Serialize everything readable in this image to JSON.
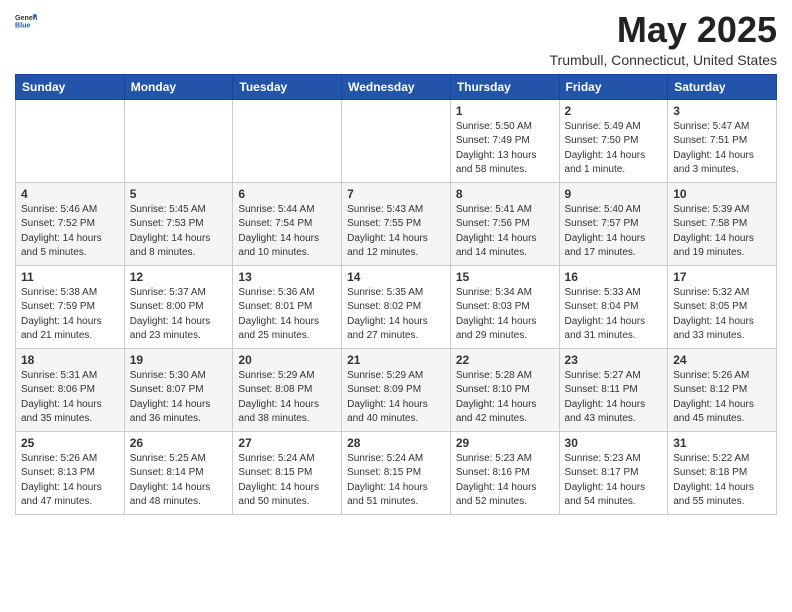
{
  "header": {
    "logo_general": "General",
    "logo_blue": "Blue",
    "month_title": "May 2025",
    "location": "Trumbull, Connecticut, United States"
  },
  "weekdays": [
    "Sunday",
    "Monday",
    "Tuesday",
    "Wednesday",
    "Thursday",
    "Friday",
    "Saturday"
  ],
  "weeks": [
    [
      {
        "day": "",
        "info": ""
      },
      {
        "day": "",
        "info": ""
      },
      {
        "day": "",
        "info": ""
      },
      {
        "day": "",
        "info": ""
      },
      {
        "day": "1",
        "info": "Sunrise: 5:50 AM\nSunset: 7:49 PM\nDaylight: 13 hours\nand 58 minutes."
      },
      {
        "day": "2",
        "info": "Sunrise: 5:49 AM\nSunset: 7:50 PM\nDaylight: 14 hours\nand 1 minute."
      },
      {
        "day": "3",
        "info": "Sunrise: 5:47 AM\nSunset: 7:51 PM\nDaylight: 14 hours\nand 3 minutes."
      }
    ],
    [
      {
        "day": "4",
        "info": "Sunrise: 5:46 AM\nSunset: 7:52 PM\nDaylight: 14 hours\nand 5 minutes."
      },
      {
        "day": "5",
        "info": "Sunrise: 5:45 AM\nSunset: 7:53 PM\nDaylight: 14 hours\nand 8 minutes."
      },
      {
        "day": "6",
        "info": "Sunrise: 5:44 AM\nSunset: 7:54 PM\nDaylight: 14 hours\nand 10 minutes."
      },
      {
        "day": "7",
        "info": "Sunrise: 5:43 AM\nSunset: 7:55 PM\nDaylight: 14 hours\nand 12 minutes."
      },
      {
        "day": "8",
        "info": "Sunrise: 5:41 AM\nSunset: 7:56 PM\nDaylight: 14 hours\nand 14 minutes."
      },
      {
        "day": "9",
        "info": "Sunrise: 5:40 AM\nSunset: 7:57 PM\nDaylight: 14 hours\nand 17 minutes."
      },
      {
        "day": "10",
        "info": "Sunrise: 5:39 AM\nSunset: 7:58 PM\nDaylight: 14 hours\nand 19 minutes."
      }
    ],
    [
      {
        "day": "11",
        "info": "Sunrise: 5:38 AM\nSunset: 7:59 PM\nDaylight: 14 hours\nand 21 minutes."
      },
      {
        "day": "12",
        "info": "Sunrise: 5:37 AM\nSunset: 8:00 PM\nDaylight: 14 hours\nand 23 minutes."
      },
      {
        "day": "13",
        "info": "Sunrise: 5:36 AM\nSunset: 8:01 PM\nDaylight: 14 hours\nand 25 minutes."
      },
      {
        "day": "14",
        "info": "Sunrise: 5:35 AM\nSunset: 8:02 PM\nDaylight: 14 hours\nand 27 minutes."
      },
      {
        "day": "15",
        "info": "Sunrise: 5:34 AM\nSunset: 8:03 PM\nDaylight: 14 hours\nand 29 minutes."
      },
      {
        "day": "16",
        "info": "Sunrise: 5:33 AM\nSunset: 8:04 PM\nDaylight: 14 hours\nand 31 minutes."
      },
      {
        "day": "17",
        "info": "Sunrise: 5:32 AM\nSunset: 8:05 PM\nDaylight: 14 hours\nand 33 minutes."
      }
    ],
    [
      {
        "day": "18",
        "info": "Sunrise: 5:31 AM\nSunset: 8:06 PM\nDaylight: 14 hours\nand 35 minutes."
      },
      {
        "day": "19",
        "info": "Sunrise: 5:30 AM\nSunset: 8:07 PM\nDaylight: 14 hours\nand 36 minutes."
      },
      {
        "day": "20",
        "info": "Sunrise: 5:29 AM\nSunset: 8:08 PM\nDaylight: 14 hours\nand 38 minutes."
      },
      {
        "day": "21",
        "info": "Sunrise: 5:29 AM\nSunset: 8:09 PM\nDaylight: 14 hours\nand 40 minutes."
      },
      {
        "day": "22",
        "info": "Sunrise: 5:28 AM\nSunset: 8:10 PM\nDaylight: 14 hours\nand 42 minutes."
      },
      {
        "day": "23",
        "info": "Sunrise: 5:27 AM\nSunset: 8:11 PM\nDaylight: 14 hours\nand 43 minutes."
      },
      {
        "day": "24",
        "info": "Sunrise: 5:26 AM\nSunset: 8:12 PM\nDaylight: 14 hours\nand 45 minutes."
      }
    ],
    [
      {
        "day": "25",
        "info": "Sunrise: 5:26 AM\nSunset: 8:13 PM\nDaylight: 14 hours\nand 47 minutes."
      },
      {
        "day": "26",
        "info": "Sunrise: 5:25 AM\nSunset: 8:14 PM\nDaylight: 14 hours\nand 48 minutes."
      },
      {
        "day": "27",
        "info": "Sunrise: 5:24 AM\nSunset: 8:15 PM\nDaylight: 14 hours\nand 50 minutes."
      },
      {
        "day": "28",
        "info": "Sunrise: 5:24 AM\nSunset: 8:15 PM\nDaylight: 14 hours\nand 51 minutes."
      },
      {
        "day": "29",
        "info": "Sunrise: 5:23 AM\nSunset: 8:16 PM\nDaylight: 14 hours\nand 52 minutes."
      },
      {
        "day": "30",
        "info": "Sunrise: 5:23 AM\nSunset: 8:17 PM\nDaylight: 14 hours\nand 54 minutes."
      },
      {
        "day": "31",
        "info": "Sunrise: 5:22 AM\nSunset: 8:18 PM\nDaylight: 14 hours\nand 55 minutes."
      }
    ]
  ]
}
